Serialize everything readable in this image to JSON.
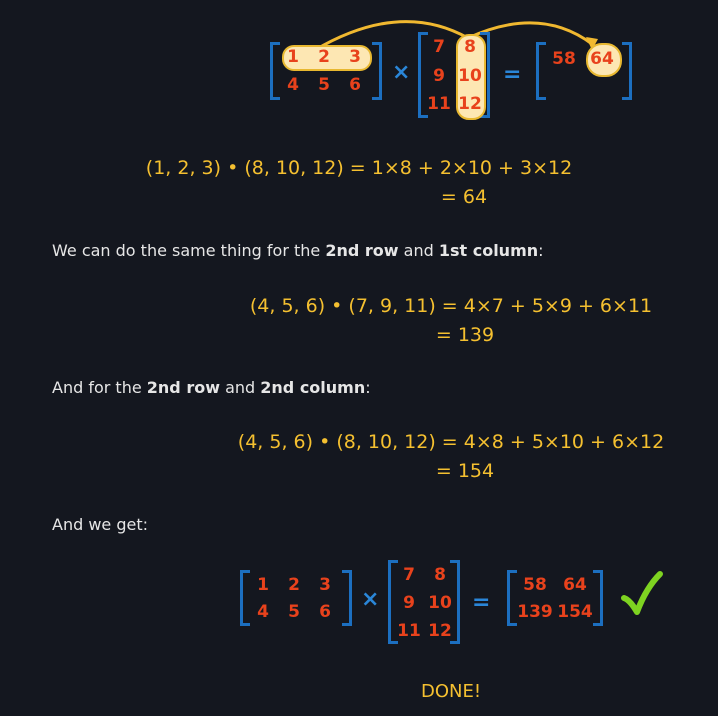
{
  "top_figure": {
    "a": [
      [
        "1",
        "2",
        "3"
      ],
      [
        "4",
        "5",
        "6"
      ]
    ],
    "b": [
      [
        "7",
        "8"
      ],
      [
        "9",
        "10"
      ],
      [
        "11",
        "12"
      ]
    ],
    "partial": [
      "58",
      "64"
    ],
    "times": "×",
    "equals": "="
  },
  "calc1": {
    "line1": "(1, 2, 3) • (8, 10, 12) = 1×8 + 2×10 + 3×12",
    "line2": "= 64"
  },
  "para1": {
    "pre": "We can do the same thing for the ",
    "b1": "2nd row",
    "mid": " and ",
    "b2": "1st column",
    "post": ":"
  },
  "calc2": {
    "line1": "(4, 5, 6) • (7, 9, 11) = 4×7 + 5×9 + 6×11",
    "line2": "= 139"
  },
  "para2": {
    "pre": "And for the ",
    "b1": "2nd row",
    "mid": " and ",
    "b2": "2nd column",
    "post": ":"
  },
  "calc3": {
    "line1": "(4, 5, 6) • (8, 10, 12) = 4×8 + 5×10 + 6×12",
    "line2": "= 154"
  },
  "para3": {
    "text": "And we get:"
  },
  "bottom_figure": {
    "a": [
      [
        "1",
        "2",
        "3"
      ],
      [
        "4",
        "5",
        "6"
      ]
    ],
    "b": [
      [
        "7",
        "8"
      ],
      [
        "9",
        "10"
      ],
      [
        "11",
        "12"
      ]
    ],
    "result": [
      [
        "58",
        "64"
      ],
      [
        "139",
        "154"
      ]
    ],
    "times": "×",
    "equals": "="
  },
  "done": "DONE!",
  "colors": {
    "background": "#14171f",
    "formula": "#f5c030",
    "matrix_number": "#e8421c",
    "bracket": "#1c6fc0",
    "highlight": "#fde7b3",
    "check": "#7ed321"
  }
}
